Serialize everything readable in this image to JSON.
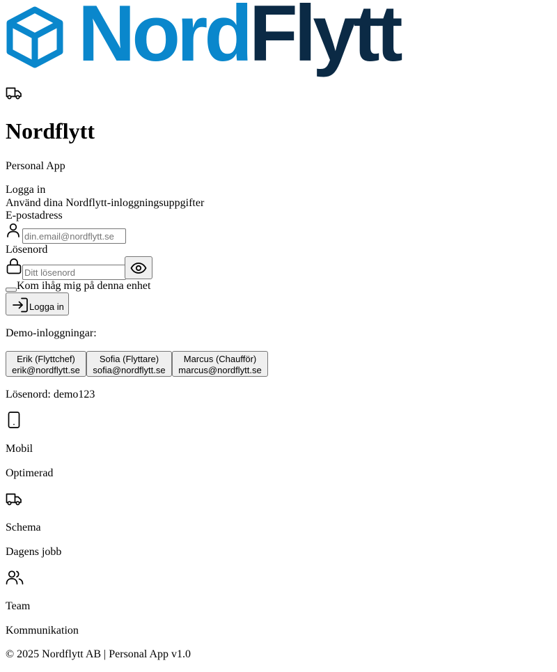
{
  "logo": {
    "nord": "Nord",
    "flytt": "Flytt",
    "nord_color": "#0a87cc",
    "flytt_color": "#0b2a45"
  },
  "header": {
    "icon": "truck-icon",
    "title": "Nordflytt",
    "subtitle": "Personal App"
  },
  "login": {
    "heading": "Logga in",
    "description": "Använd dina Nordflytt-inloggningsuppgifter",
    "email_label": "E-postadress",
    "email_icon": "user-icon",
    "email_placeholder": "din.email@nordflytt.se",
    "email_value": "",
    "password_label": "Lösenord",
    "password_icon": "lock-icon",
    "password_placeholder": "Ditt lösenord",
    "password_value": "",
    "toggle_icon": "eye-icon",
    "remember_label": "Kom ihåg mig på denna enhet",
    "remember_checked": false,
    "submit_icon": "log-in-icon",
    "submit_label": "Logga in"
  },
  "demo": {
    "heading": "Demo-inloggningar:",
    "users": [
      {
        "name": "Erik (Flyttchef)",
        "email": "erik@nordflytt.se"
      },
      {
        "name": "Sofia (Flyttare)",
        "email": "sofia@nordflytt.se"
      },
      {
        "name": "Marcus (Chaufför)",
        "email": "marcus@nordflytt.se"
      }
    ],
    "password_note": "Lösenord: demo123"
  },
  "features": [
    {
      "icon": "smartphone-icon",
      "title": "Mobil",
      "subtitle": "Optimerad"
    },
    {
      "icon": "truck-icon",
      "title": "Schema",
      "subtitle": "Dagens jobb"
    },
    {
      "icon": "users-icon",
      "title": "Team",
      "subtitle": "Kommunikation"
    }
  ],
  "footer": {
    "text": "© 2025 Nordflytt AB | Personal App v1.0"
  }
}
